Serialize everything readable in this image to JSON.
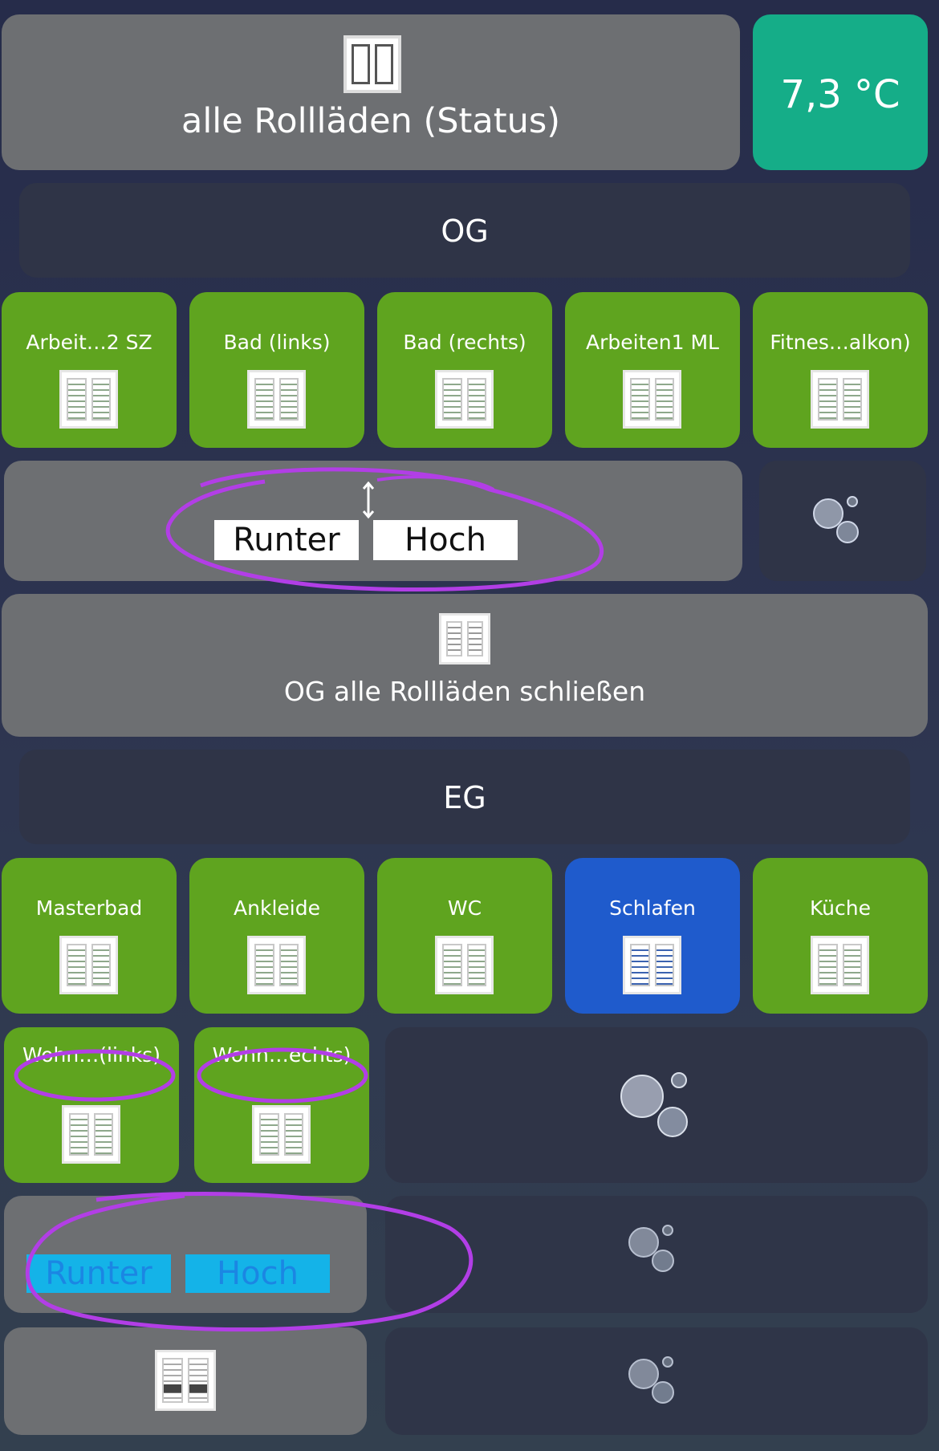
{
  "header": {
    "all_shutters_status_label": "alle Rollläden (Status)",
    "temperature": "7,3 °C"
  },
  "og": {
    "section_title": "OG",
    "rooms": [
      {
        "label": "Arbeit…2   SZ",
        "state": "green"
      },
      {
        "label": "Bad  (links)",
        "state": "green"
      },
      {
        "label": "Bad (rechts)",
        "state": "green"
      },
      {
        "label": "Arbeiten1   ML",
        "state": "green"
      },
      {
        "label": "Fitnes…alkon)",
        "state": "green"
      }
    ],
    "down_label": "Runter",
    "up_label": "Hoch",
    "close_all_label": "OG alle Rollläden schließen"
  },
  "eg": {
    "section_title": "EG",
    "rooms": [
      {
        "label": "Masterbad",
        "state": "green"
      },
      {
        "label": "Ankleide",
        "state": "green"
      },
      {
        "label": "WC",
        "state": "green"
      },
      {
        "label": "Schlafen",
        "state": "blue"
      },
      {
        "label": "Küche",
        "state": "green"
      }
    ],
    "living_rooms": [
      {
        "label": "Wohn…(links)"
      },
      {
        "label": "Wohn…echts)"
      }
    ],
    "down_label": "Runter",
    "up_label": "Hoch"
  },
  "colors": {
    "green_tile": "#5fa41f",
    "blue_tile": "#1f5bcc",
    "teal_tile": "#15ad88",
    "annotation": "#b23ee6"
  }
}
